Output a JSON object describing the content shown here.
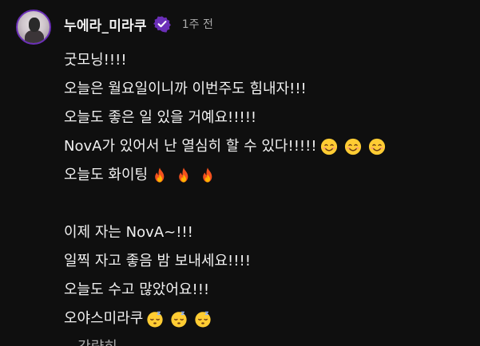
{
  "channel": {
    "name": "누에라_미라쿠",
    "verified_icon": "verified-check-icon",
    "accent_color": "#6b2fb8",
    "timestamp": "1주 전"
  },
  "post": {
    "lines": [
      "굿모닝!!!!",
      "오늘은 월요일이니까 이번주도 힘내자!!!",
      "오늘도 좋은 일 있을 거예요!!!!!",
      "NovA가 있어서 난 열심히 할 수 있다!!!!!",
      "오늘도 화이팅",
      "",
      "이제 자는 NovA~!!!",
      "일찍 자고 좋음 밤 보내세요!!!!",
      "오늘도 수고 많았어요!!!",
      "오야스미라쿠"
    ],
    "emoji": {
      "smile": "smiling-face-icon",
      "fire": "fire-icon",
      "sleep": "sleeping-face-icon"
    },
    "read_more": "...간략히"
  }
}
